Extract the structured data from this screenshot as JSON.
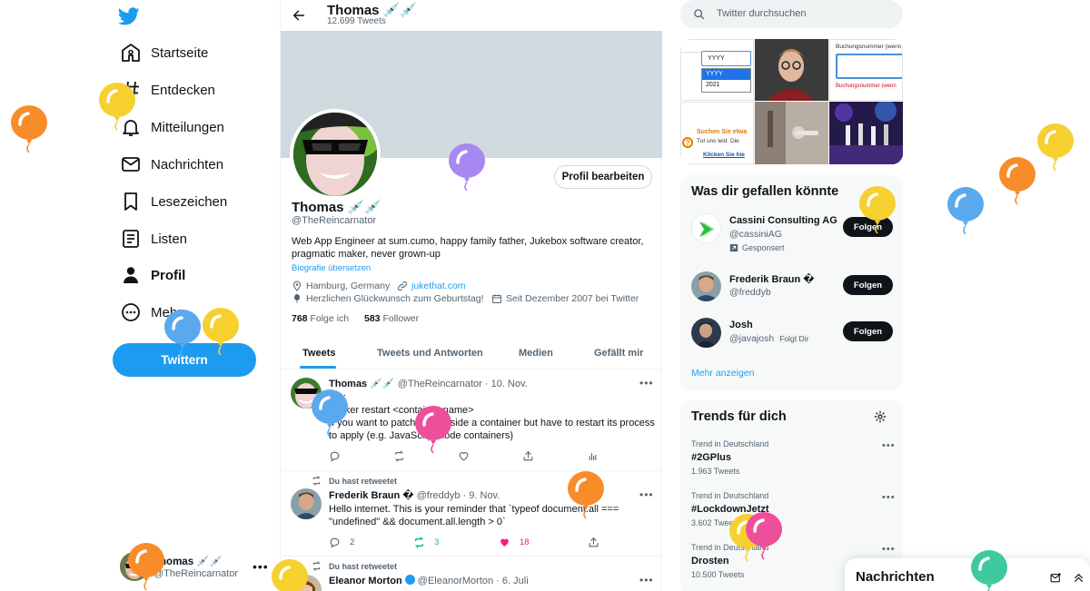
{
  "nav": {
    "items": [
      {
        "label": "Startseite",
        "icon": "home-icon"
      },
      {
        "label": "Entdecken",
        "icon": "hashtag-icon"
      },
      {
        "label": "Mitteilungen",
        "icon": "bell-icon"
      },
      {
        "label": "Nachrichten",
        "icon": "envelope-icon"
      },
      {
        "label": "Lesezeichen",
        "icon": "bookmark-icon"
      },
      {
        "label": "Listen",
        "icon": "list-icon"
      },
      {
        "label": "Profil",
        "icon": "person-icon"
      },
      {
        "label": "Mehr",
        "icon": "more-circle-icon"
      }
    ],
    "tweet_button": "Twittern",
    "account": {
      "name": "Thomas 💉💉",
      "handle": "@TheReincarnator"
    }
  },
  "profile": {
    "topbar_name": "Thomas 💉💉",
    "tweet_count": "12.699 Tweets",
    "edit_button": "Profil bearbeiten",
    "name": "Thomas 💉💉",
    "handle": "@TheReincarnator",
    "bio": "Web App Engineer at sum.cumo, happy family father, Jukebox software creator, pragmatic maker, never grown-up",
    "translate": "Biografie übersetzen",
    "location": "Hamburg, Germany",
    "website": "jukethat.com",
    "birthday": "Herzlichen Glückwunsch zum Geburtstag!",
    "joined": "Seit Dezember 2007 bei Twitter",
    "following_count": "768",
    "following_label": "Folge ich",
    "followers_count": "583",
    "followers_label": "Follower"
  },
  "tabs": [
    "Tweets",
    "Tweets und Antworten",
    "Medien",
    "Gefällt mir"
  ],
  "tweets": [
    {
      "retweet_note": "",
      "name": "Thomas 💉💉",
      "handle": "@TheReincarnator",
      "date": "10. Nov.",
      "text": "TIL:\ndocker restart <container-name>\nIf you want to patch code inside a container but have to restart its process\nto apply (e.g. JavaScript node containers)",
      "replies": "",
      "retweets": "",
      "likes": ""
    },
    {
      "retweet_note": "Du hast retweetet",
      "name": "Frederik Braun �",
      "handle": "@freddyb",
      "date": "9. Nov.",
      "text": "Hello internet. This is your reminder that `typeof document.all ===\n\"undefined\" && document.all.length > 0`",
      "replies": "2",
      "retweets": "3",
      "likes": "18"
    },
    {
      "retweet_note": "Du hast retweetet",
      "name": "Eleanor Morton",
      "handle": "@EleanorMorton",
      "date": "6. Juli",
      "text": "",
      "replies": "",
      "retweets": "",
      "likes": ""
    }
  ],
  "search": {
    "placeholder": "Twitter durchsuchen"
  },
  "media_grid": {
    "yyyy_select": "YYYY",
    "yyyy_options": [
      "YYYY",
      "2021"
    ],
    "booking_label": "Buchungsnummer (wenn",
    "booking_error": "Buchungsnummer (wenn",
    "search_prompt": "Suchen Sie etwa",
    "sorry_text": "Tut uns leid.  Die",
    "click_link": "Klicken Sie hie"
  },
  "who_to_follow": {
    "title": "Was dir gefallen könnte",
    "items": [
      {
        "name": "Cassini Consulting AG",
        "handle": "@cassiniAG",
        "badge": "",
        "promoted": "Gesponsert",
        "button": "Folgen"
      },
      {
        "name": "Frederik Braun �",
        "handle": "@freddyb",
        "badge": "",
        "promoted": "",
        "button": "Folgen"
      },
      {
        "name": "Josh",
        "handle": "@javajosh",
        "badge": "Folgt Dir",
        "promoted": "",
        "button": "Folgen"
      }
    ],
    "show_more": "Mehr anzeigen"
  },
  "trends": {
    "title": "Trends für dich",
    "items": [
      {
        "context": "Trend in Deutschland",
        "name": "#2GPlus",
        "count": "1.963 Tweets"
      },
      {
        "context": "Trend in Deutschland",
        "name": "#LockdownJetzt",
        "count": "3.602 Tweets"
      },
      {
        "context": "Trend in Deutschland",
        "name": "Drosten",
        "count": "10.500 Tweets"
      }
    ]
  },
  "messages_dock": {
    "title": "Nachrichten"
  },
  "colors": {
    "accent": "#1d9bf0",
    "text": "#0f1419",
    "muted": "#536471",
    "like": "#f91880",
    "retweet": "#00ba7c",
    "balloons": [
      "#f88c2a",
      "#f6d02f",
      "#5aa9ee",
      "#a788f0",
      "#ee4f9b",
      "#3fc99f"
    ]
  }
}
